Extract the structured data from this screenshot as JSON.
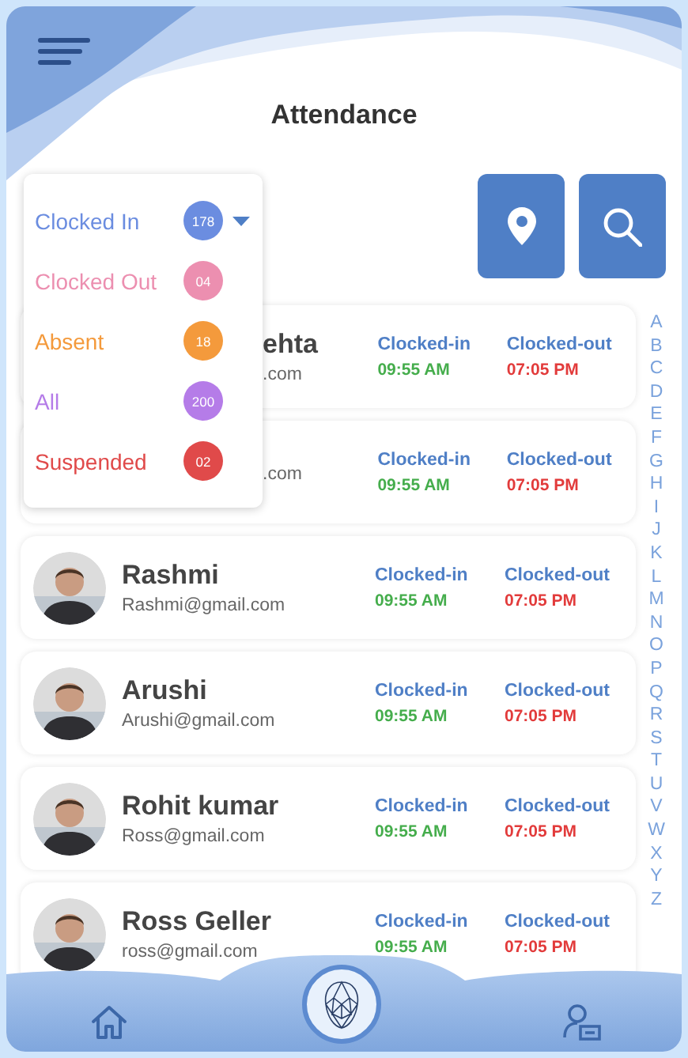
{
  "header": {
    "title": "Attendance"
  },
  "toolbar": {
    "buttons": [
      {
        "kind": "location"
      },
      {
        "kind": "search"
      }
    ]
  },
  "filter": {
    "expanded": true,
    "options": [
      {
        "label": "Clocked In",
        "count": "178",
        "color": "#6b8de0",
        "selected": true
      },
      {
        "label": "Clocked Out",
        "count": "04",
        "color": "#ec8fb0",
        "selected": false
      },
      {
        "label": "Absent",
        "count": "18",
        "color": "#f49a3c",
        "selected": false
      },
      {
        "label": "All",
        "count": "200",
        "color": "#b57ce8",
        "selected": false
      },
      {
        "label": "Suspended",
        "count": "02",
        "color": "#e04a4a",
        "selected": false
      }
    ]
  },
  "employees": [
    {
      "covered": true,
      "name": "ehta",
      "email": ".com",
      "in_label": "Clocked-in",
      "in_time": "09:55 AM",
      "out_label": "Clocked-out",
      "out_time": "07:05 PM"
    },
    {
      "covered": true,
      "email": ".com",
      "in_label": "Clocked-in",
      "in_time": "09:55 AM",
      "out_label": "Clocked-out",
      "out_time": "07:05 PM"
    },
    {
      "covered": false,
      "name": "Rashmi",
      "email": "Rashmi@gmail.com",
      "in_label": "Clocked-in",
      "in_time": "09:55 AM",
      "out_label": "Clocked-out",
      "out_time": "07:05 PM"
    },
    {
      "covered": false,
      "name": "Arushi",
      "email": "Arushi@gmail.com",
      "in_label": "Clocked-in",
      "in_time": "09:55 AM",
      "out_label": "Clocked-out",
      "out_time": "07:05 PM"
    },
    {
      "covered": false,
      "name": "Rohit kumar",
      "email": "Ross@gmail.com",
      "in_label": "Clocked-in",
      "in_time": "09:55 AM",
      "out_label": "Clocked-out",
      "out_time": "07:05 PM"
    },
    {
      "covered": false,
      "name": "Ross Geller",
      "email": "ross@gmail.com",
      "in_label": "Clocked-in",
      "in_time": "09:55 AM",
      "out_label": "Clocked-out",
      "out_time": "07:05 PM"
    }
  ],
  "alphabet": [
    "A",
    "B",
    "C",
    "D",
    "E",
    "F",
    "G",
    "H",
    "I",
    "J",
    "K",
    "L",
    "M",
    "N",
    "O",
    "P",
    "Q",
    "R",
    "S",
    "T",
    "U",
    "V",
    "W",
    "X",
    "Y",
    "Z"
  ],
  "bottom_nav": [
    {
      "kind": "home"
    },
    {
      "kind": "face-scan"
    },
    {
      "kind": "profile"
    }
  ]
}
